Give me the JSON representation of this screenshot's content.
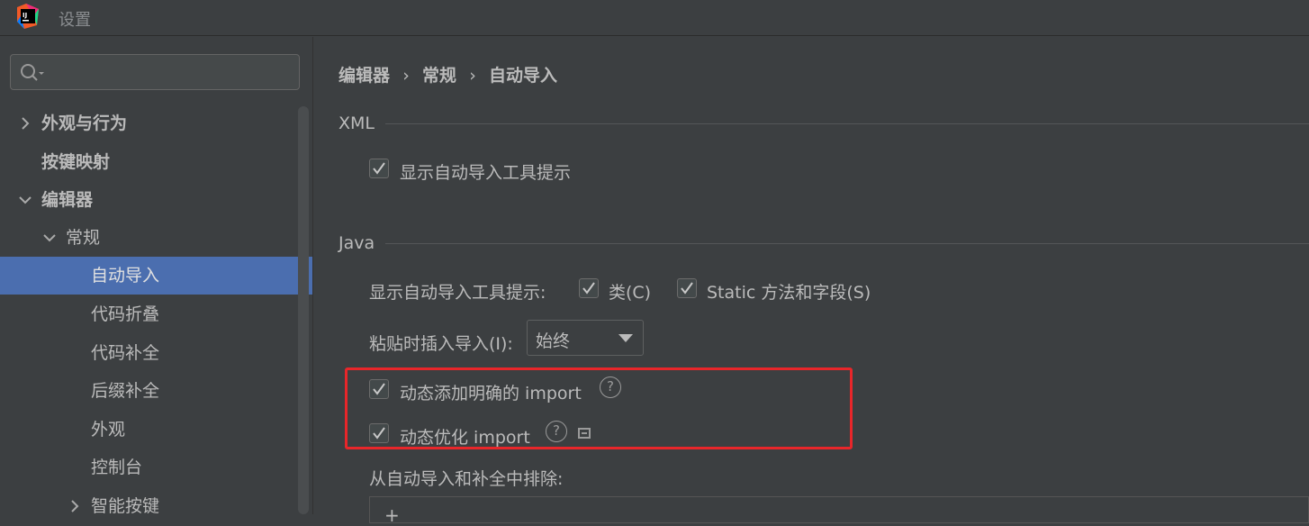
{
  "window": {
    "title": "设置"
  },
  "search": {
    "placeholder": "",
    "value": ""
  },
  "sidebar": {
    "items": [
      {
        "label": "外观与行为",
        "arrow": "right",
        "bold": true
      },
      {
        "label": "按键映射",
        "arrow": "none",
        "bold": true
      },
      {
        "label": "编辑器",
        "arrow": "down",
        "bold": true
      },
      {
        "label": "常规",
        "arrow": "down",
        "bold": false
      },
      {
        "label": "自动导入",
        "arrow": "none",
        "bold": false,
        "selected": true
      },
      {
        "label": "代码折叠",
        "arrow": "none",
        "bold": false
      },
      {
        "label": "代码补全",
        "arrow": "none",
        "bold": false
      },
      {
        "label": "后缀补全",
        "arrow": "none",
        "bold": false
      },
      {
        "label": "外观",
        "arrow": "none",
        "bold": false
      },
      {
        "label": "控制台",
        "arrow": "none",
        "bold": false
      },
      {
        "label": "智能按键",
        "arrow": "right",
        "bold": false
      }
    ]
  },
  "breadcrumb": {
    "part1": "编辑器",
    "part2": "常规",
    "part3": "自动导入",
    "separator": "›"
  },
  "xml_section": {
    "title": "XML",
    "show_tooltip_label": "显示自动导入工具提示",
    "show_tooltip_checked": true
  },
  "java_section": {
    "title": "Java",
    "show_tooltip_label": "显示自动导入工具提示:",
    "class_label": "类(C)",
    "class_checked": true,
    "static_label": "Static 方法和字段(S)",
    "static_checked": true,
    "paste_label": "粘贴时插入导入(I):",
    "paste_value": "始终",
    "add_unambiguous_label": "动态添加明确的 import",
    "add_unambiguous_checked": true,
    "optimize_label": "动态优化 import",
    "optimize_checked": true,
    "exclude_label": "从自动导入和补全中排除:",
    "help_glyph": "?",
    "add_glyph": "+"
  },
  "colors": {
    "background": "#3c3f41",
    "selection": "#4b6eaf",
    "highlight_border": "#e8262a",
    "text": "#bbbbbb"
  }
}
